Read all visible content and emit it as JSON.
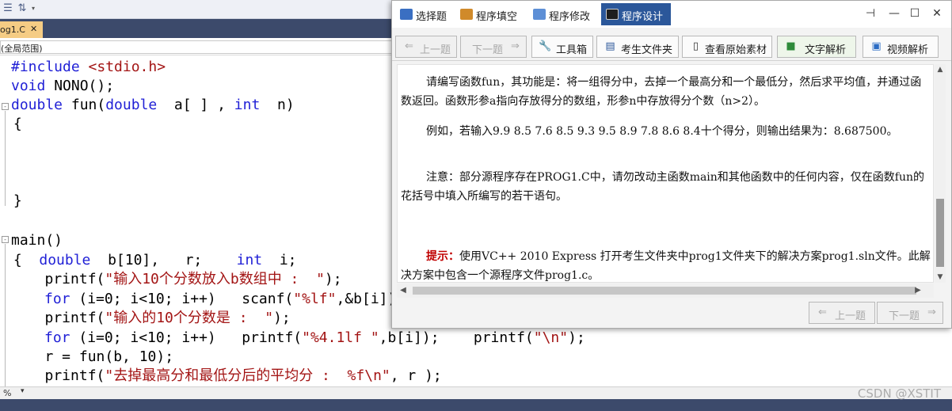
{
  "editor": {
    "tab_label": "og1.C",
    "tab_close": "✕",
    "scope": "(全局范围)",
    "code": {
      "l1_kw": "#include",
      "l1_rest": " <stdio.h>",
      "l2_kw": "void",
      "l2_rest": " NONO();",
      "l3_kw1": "double",
      "l3_mid": " fun(",
      "l3_kw2": "double",
      "l3_mid2": "  a[ ] , ",
      "l3_kw3": "int",
      "l3_end": "  n)",
      "l4": " {",
      "l8": " }",
      "l10": "main()",
      "l11_a": " {  ",
      "l11_kw1": "double",
      "l11_b": "  b[10],   r;    ",
      "l11_kw2": "int",
      "l11_c": "  i;",
      "l12_a": "   printf(",
      "l12_str": "\"输入10个分数放入b数组中 :  \"",
      "l12_b": ");",
      "l13_kw": "for",
      "l13_a": " (i=0; i<10; i++)   scanf(",
      "l13_str": "\"%lf\"",
      "l13_b": ",&b[i])",
      "l14_a": "   printf(",
      "l14_str": "\"输入的10个分数是 :  \"",
      "l14_b": ");",
      "l15_kw": "for",
      "l15_a": " (i=0; i<10; i++)   printf(",
      "l15_str1": "\"%4.1lf \"",
      "l15_b": ",b[i]);    printf(",
      "l15_str2": "\"\\n\"",
      "l15_c": ");",
      "l16": "   r = fun(b, 10);",
      "l17_a": "   printf(",
      "l17_str": "\"去掉最高分和最低分后的平均分 :  %f\\n\"",
      "l17_b": ", r );"
    },
    "status_zoom": "%",
    "watermark": "CSDN @XSTIT"
  },
  "dialog": {
    "tabs": [
      "选择题",
      "程序填空",
      "程序修改",
      "程序设计"
    ],
    "win_pin": "⊣",
    "win_min": "—",
    "win_max": "☐",
    "win_close": "✕",
    "buttons": {
      "prev": "上一题",
      "next": "下一题",
      "toolbox": "工具箱",
      "exam_folder": "考生文件夹",
      "view_source": "查看原始素材",
      "text_analysis": "文字解析",
      "video_analysis": "视频解析"
    },
    "question": {
      "p1": "请编写函数fun，其功能是：将一组得分中，去掉一个最高分和一个最低分，然后求平均值，并通过函数返回。函数形参a指向存放得分的数组，形参n中存放得分个数（n>2）。",
      "p2": "例如，若输入9.9  8.5  7.6  8.5  9.3  9.5  8.9  7.8  8.6  8.4十个得分，则输出结果为：8.687500。",
      "p3": "注意：部分源程序存在PROG1.C中，请勿改动主函数main和其他函数中的任何内容，仅在函数fun的花括号中填入所编写的若干语句。",
      "hint_label": "提示：",
      "hint_text": "使用VC++ 2010 Express 打开考生文件夹中prog1文件夹下的解决方案prog1.sln文件。此解决方案中包含一个源程序文件prog1.c。"
    }
  },
  "colors": {
    "keyword": "#1f1fd6",
    "string": "#a31515",
    "hint": "#c00000",
    "active_tab": "#2b579a",
    "editor_tab": "#f5cc84"
  }
}
